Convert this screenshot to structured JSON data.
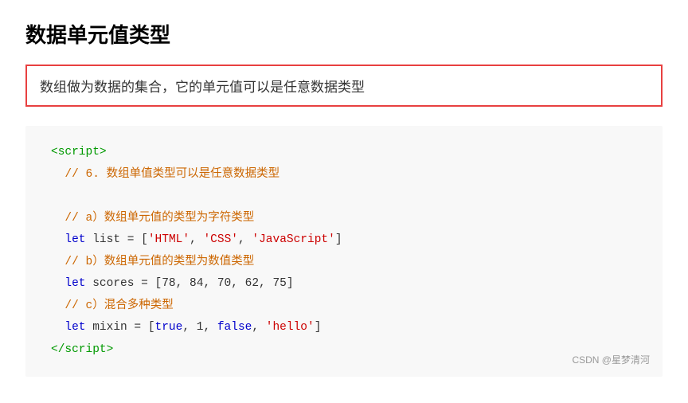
{
  "page": {
    "title": "数据单元值类型",
    "highlight_text": "数组做为数据的集合，它的单元值可以是任意数据类型",
    "watermark": "CSDN @星梦清河",
    "code": {
      "script_open": "<script>",
      "script_close": "</script>",
      "comment_6": "// 6. 数组单值类型可以是任意数据类型",
      "comment_a": "// a）数组单元值的类型为字符类型",
      "line_list": "  let list = ['HTML', 'CSS', 'JavaScript']",
      "comment_b": "// b）数组单元值的类型为数值类型",
      "line_scores": "  let scores = [78, 84, 70, 62, 75]",
      "comment_c": "// c）混合多种类型",
      "line_mixin": "  let mixin = [true, 1, false, 'hello']"
    }
  }
}
